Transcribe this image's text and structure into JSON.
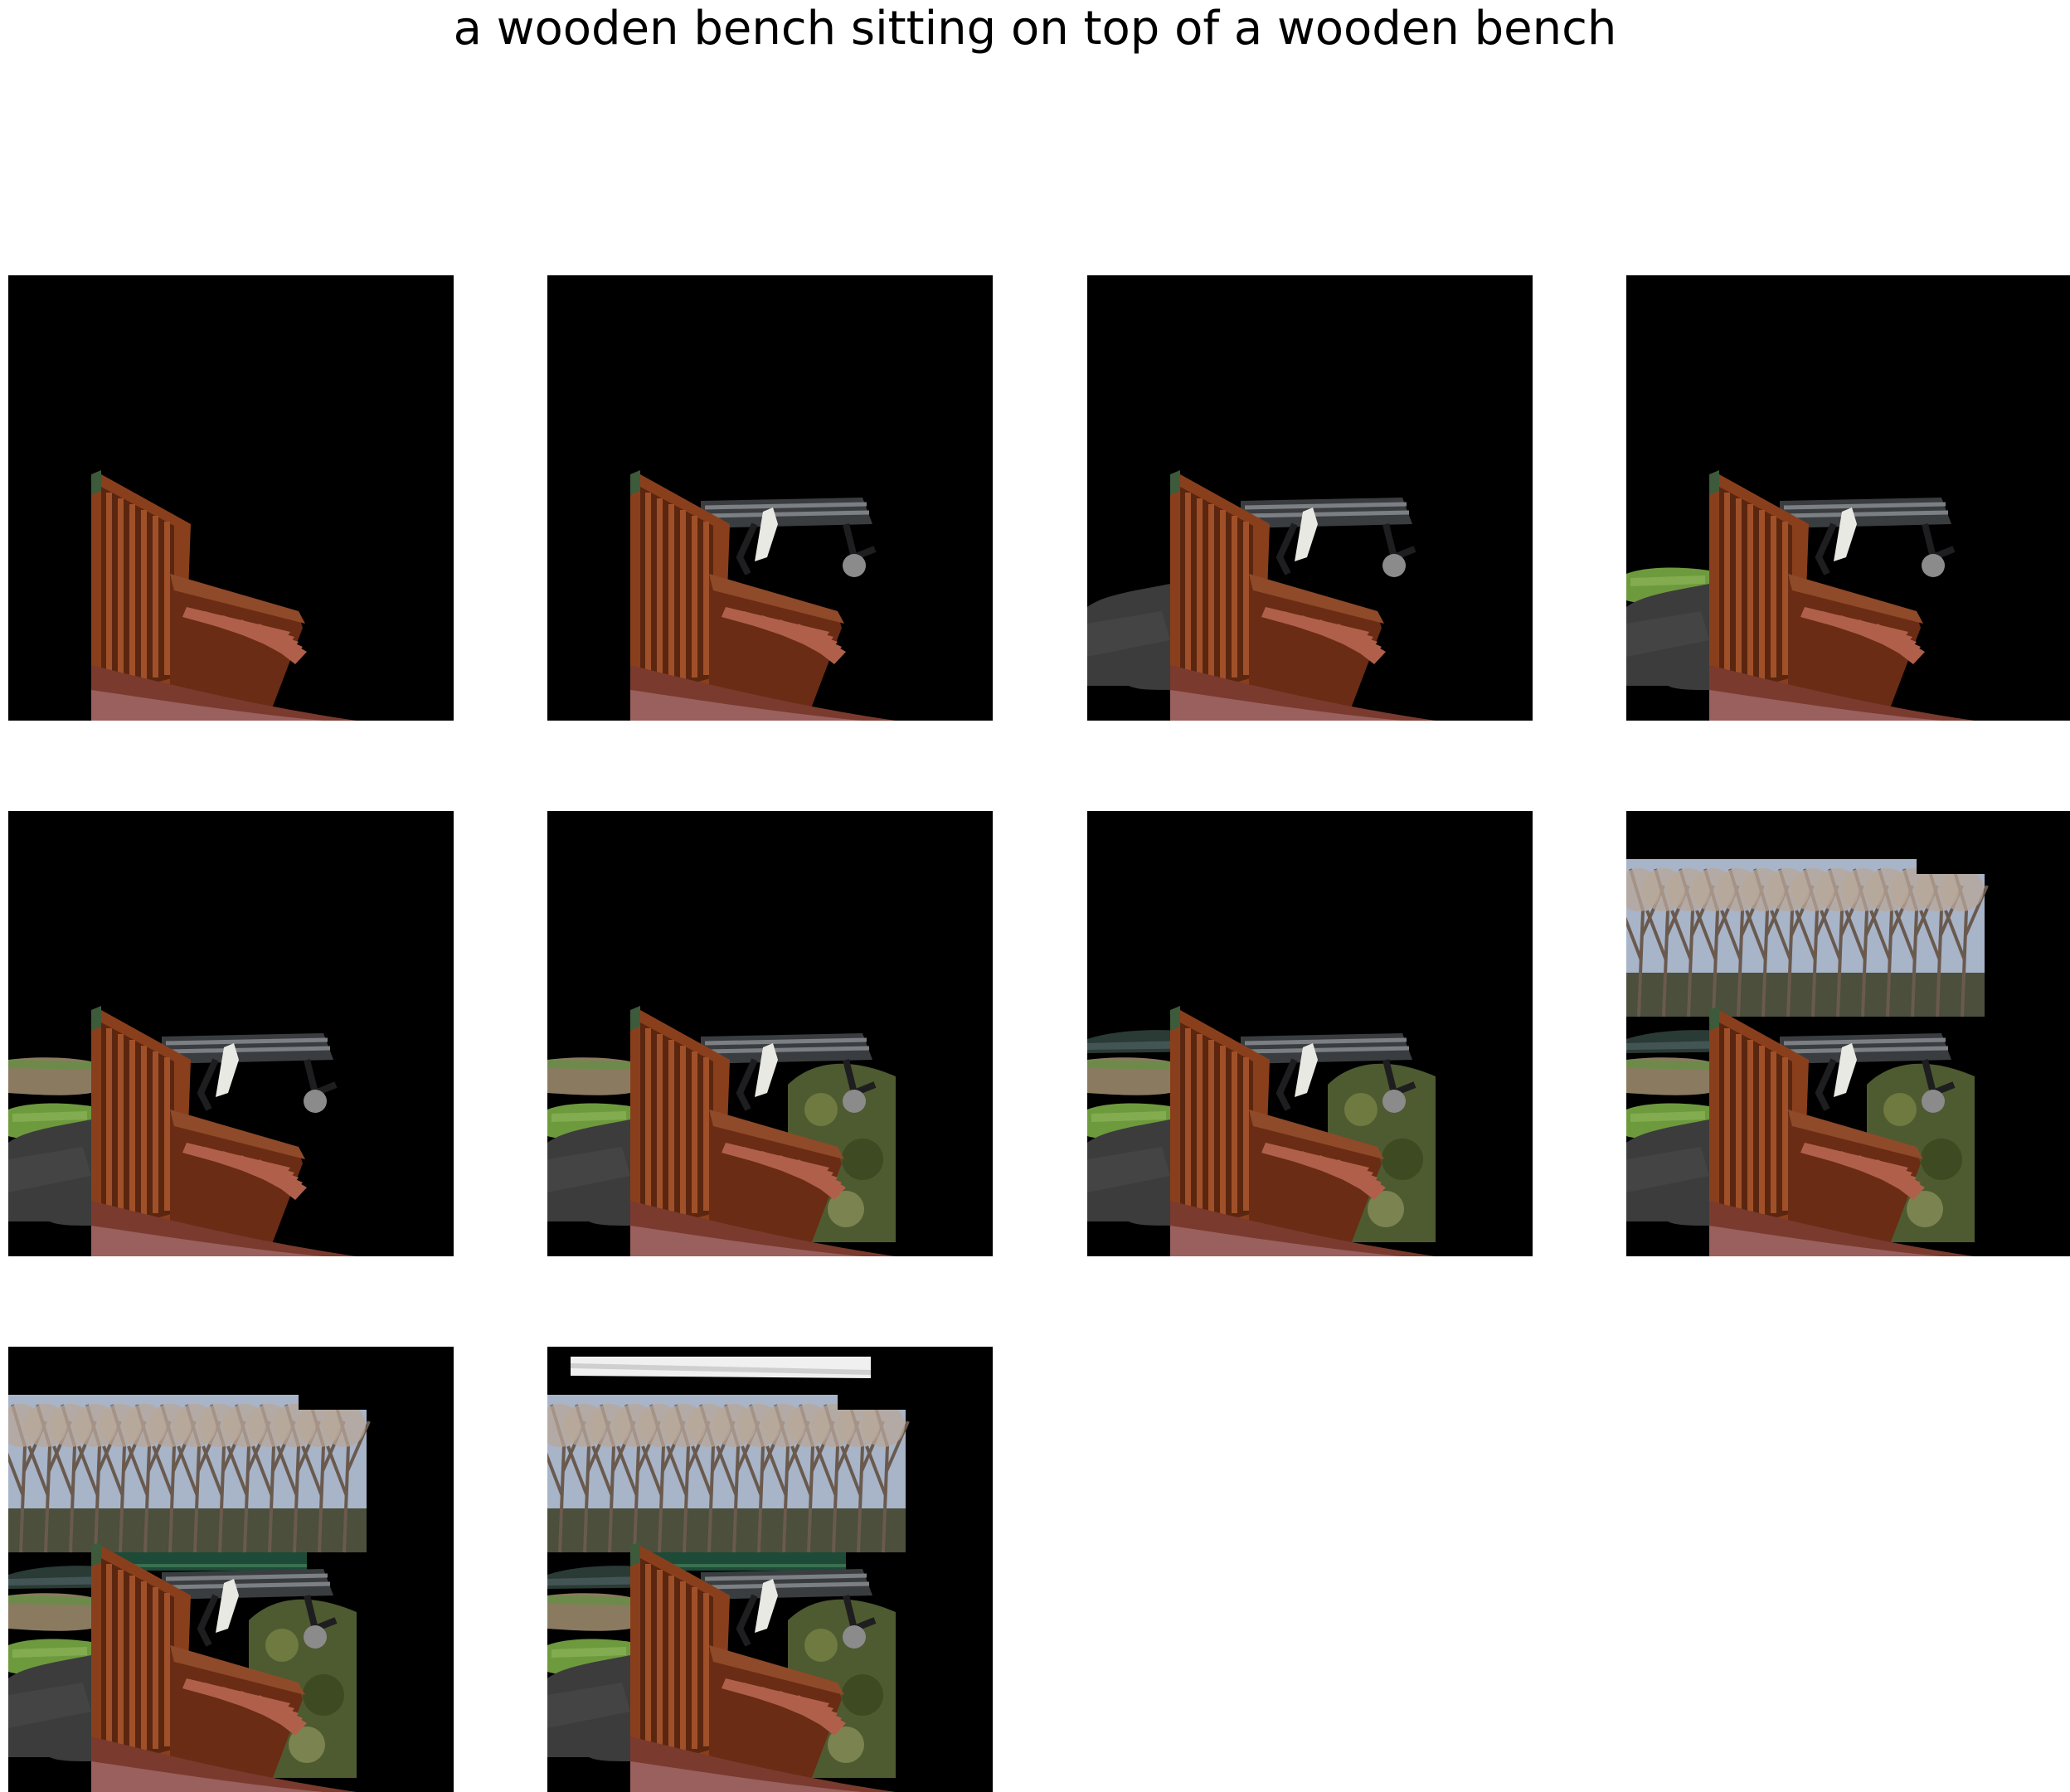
{
  "figure": {
    "title": "a wooden bench sitting on top of a wooden bench",
    "rows": 3,
    "columns": 4,
    "panels": [
      {
        "index": 1,
        "layers": [
          "bench"
        ]
      },
      {
        "index": 2,
        "layers": [
          "bench",
          "metal-bench"
        ]
      },
      {
        "index": 3,
        "layers": [
          "bench",
          "metal-bench",
          "pavement"
        ]
      },
      {
        "index": 4,
        "layers": [
          "bench",
          "metal-bench",
          "pavement",
          "grass"
        ]
      },
      {
        "index": 5,
        "layers": [
          "bench",
          "metal-bench",
          "pavement",
          "grass",
          "dirt"
        ]
      },
      {
        "index": 6,
        "layers": [
          "bench",
          "metal-bench",
          "pavement",
          "grass",
          "dirt",
          "bush"
        ]
      },
      {
        "index": 7,
        "layers": [
          "bench",
          "metal-bench",
          "pavement",
          "grass",
          "dirt",
          "bush",
          "hedge"
        ]
      },
      {
        "index": 8,
        "layers": [
          "bench",
          "metal-bench",
          "pavement",
          "grass",
          "dirt",
          "bush",
          "hedge",
          "trees"
        ]
      },
      {
        "index": 9,
        "layers": [
          "bench",
          "metal-bench",
          "pavement",
          "grass",
          "dirt",
          "bush",
          "hedge",
          "trees",
          "fence"
        ]
      },
      {
        "index": 10,
        "layers": [
          "bench",
          "metal-bench",
          "pavement",
          "grass",
          "dirt",
          "bush",
          "hedge",
          "trees",
          "fence",
          "roof"
        ]
      }
    ],
    "colors": {
      "background": "#000000",
      "wood": "#8a3f1c",
      "wood_light": "#b0604a",
      "metal": "#3a3d40",
      "grass": "#6e9a3e",
      "pavement": "#3c3c3c",
      "trees": "#b8a79a",
      "bush": "#4e5a30"
    }
  }
}
